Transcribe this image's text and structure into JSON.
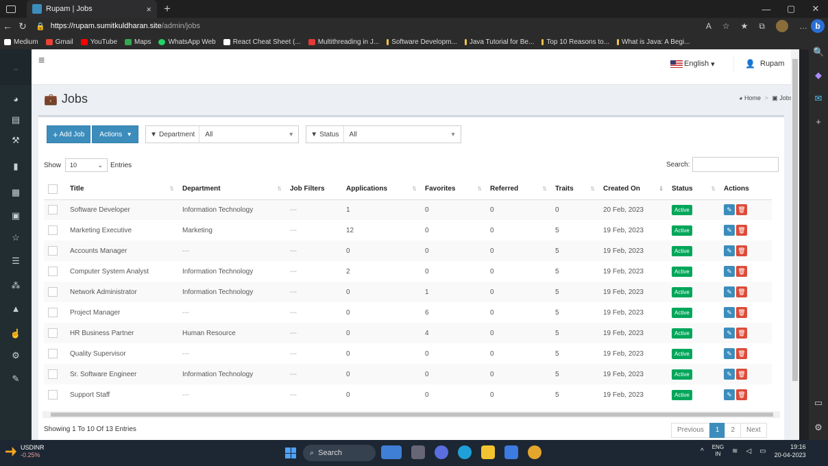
{
  "browser": {
    "tab_title": "Rupam | Jobs",
    "url_host": "https://rupam.sumitkuldharan.site",
    "url_path": "/admin/jobs",
    "bookmarks": [
      "Medium",
      "Gmail",
      "YouTube",
      "Maps",
      "WhatsApp Web",
      "React Cheat Sheet (...",
      "Multithreading in J...",
      "Software Developm...",
      "Java Tutorial for Be...",
      "Top 10 Reasons to...",
      "What is Java: A Begi..."
    ],
    "bookmark_colors": [
      "#ffffff",
      "#ea4335",
      "#ff0000",
      "#34a853",
      "#25d366",
      "#ffffff",
      "#e53935",
      "#f6c445",
      "#f6c445",
      "#f6c445",
      "#f6c445"
    ]
  },
  "header": {
    "language": "English",
    "user": "Rupam"
  },
  "page": {
    "title": "Jobs",
    "breadcrumb_home": "Home",
    "breadcrumb_current": "Jobs"
  },
  "toolbar": {
    "add_label": "Add Job",
    "actions_label": "Actions",
    "department_label": "Department",
    "department_value": "All",
    "status_label": "Status",
    "status_value": "All"
  },
  "table_controls": {
    "show_label": "Show",
    "entries_value": "10",
    "entries_label": "Entries",
    "search_label": "Search:"
  },
  "columns": [
    "Title",
    "Department",
    "Job Filters",
    "Applications",
    "Favorites",
    "Referred",
    "Traits",
    "Created On",
    "Status",
    "Actions"
  ],
  "rows": [
    {
      "title": "Software Developer",
      "department": "Information Technology",
      "filters": "---",
      "applications": "1",
      "favorites": "0",
      "referred": "0",
      "traits": "0",
      "created": "20 Feb, 2023",
      "status": "Active"
    },
    {
      "title": "Marketing Executive",
      "department": "Marketing",
      "filters": "---",
      "applications": "12",
      "favorites": "0",
      "referred": "0",
      "traits": "5",
      "created": "19 Feb, 2023",
      "status": "Active"
    },
    {
      "title": "Accounts Manager",
      "department": "---",
      "filters": "---",
      "applications": "0",
      "favorites": "0",
      "referred": "0",
      "traits": "5",
      "created": "19 Feb, 2023",
      "status": "Active"
    },
    {
      "title": "Computer System Analyst",
      "department": "Information Technology",
      "filters": "---",
      "applications": "2",
      "favorites": "0",
      "referred": "0",
      "traits": "5",
      "created": "19 Feb, 2023",
      "status": "Active"
    },
    {
      "title": "Network Administrator",
      "department": "Information Technology",
      "filters": "---",
      "applications": "0",
      "favorites": "1",
      "referred": "0",
      "traits": "5",
      "created": "19 Feb, 2023",
      "status": "Active"
    },
    {
      "title": "Project Manager",
      "department": "---",
      "filters": "---",
      "applications": "0",
      "favorites": "6",
      "referred": "0",
      "traits": "5",
      "created": "19 Feb, 2023",
      "status": "Active"
    },
    {
      "title": "HR Business Partner",
      "department": "Human Resource",
      "filters": "---",
      "applications": "0",
      "favorites": "4",
      "referred": "0",
      "traits": "5",
      "created": "19 Feb, 2023",
      "status": "Active"
    },
    {
      "title": "Quality Supervisor",
      "department": "---",
      "filters": "---",
      "applications": "0",
      "favorites": "0",
      "referred": "0",
      "traits": "5",
      "created": "19 Feb, 2023",
      "status": "Active"
    },
    {
      "title": "Sr. Software Engineer",
      "department": "Information Technology",
      "filters": "---",
      "applications": "0",
      "favorites": "0",
      "referred": "0",
      "traits": "5",
      "created": "19 Feb, 2023",
      "status": "Active"
    },
    {
      "title": "Support Staff",
      "department": "---",
      "filters": "---",
      "applications": "0",
      "favorites": "0",
      "referred": "0",
      "traits": "5",
      "created": "19 Feb, 2023",
      "status": "Active"
    }
  ],
  "footer": {
    "showing": "Showing 1 To 10 Of 13 Entries",
    "previous": "Previous",
    "page1": "1",
    "page2": "2",
    "next": "Next"
  },
  "taskbar": {
    "ticker_symbol": "USDINR",
    "ticker_change": "-0.25%",
    "search": "Search",
    "lang_line1": "ENG",
    "lang_line2": "IN",
    "time": "19:16",
    "date": "20-04-2023"
  },
  "colors": {
    "primary": "#3c8dbc",
    "success": "#00a65a",
    "danger": "#dd4b39",
    "sidebar": "#222d32"
  }
}
